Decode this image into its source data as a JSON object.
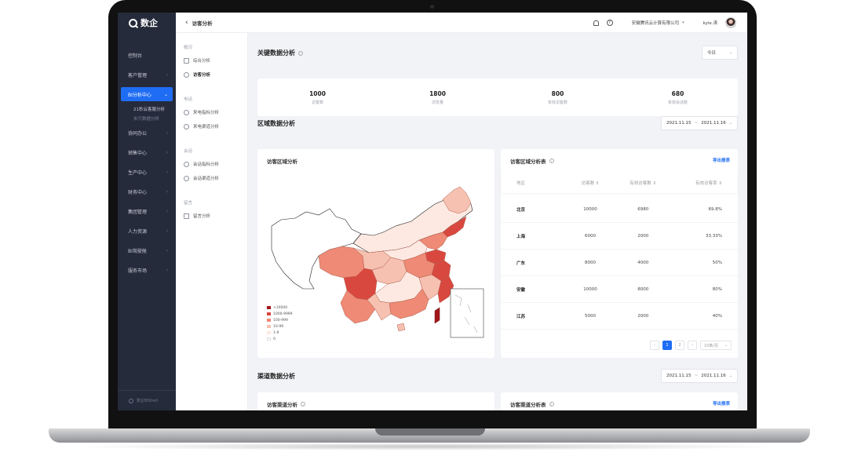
{
  "app": {
    "logo_text": "数企"
  },
  "sidebar": {
    "items": [
      {
        "label": "控制台"
      },
      {
        "label": "客户管理"
      },
      {
        "label": "BI分析中心"
      },
      {
        "label": "协同办公"
      },
      {
        "label": "销售中心"
      },
      {
        "label": "生产中心"
      },
      {
        "label": "财务中心"
      },
      {
        "label": "集团管理"
      },
      {
        "label": "人力资源"
      },
      {
        "label": "BI驾驶舱"
      },
      {
        "label": "服务市场"
      }
    ],
    "subitems": [
      {
        "label": "21秒云客服分析"
      },
      {
        "label": "米只数据分析"
      }
    ],
    "footer_text": "数企BIShell"
  },
  "topbar": {
    "back_icon": "chevron-left-icon",
    "title": "访客分析",
    "help_glyph": "?",
    "company": "安徽腾讯云计算有限公司",
    "user": "kyle.涛"
  },
  "submenu": {
    "groups": [
      {
        "title": "概况",
        "items": [
          {
            "label": "综合分析"
          },
          {
            "label": "访客分析"
          }
        ]
      },
      {
        "title": "电话",
        "items": [
          {
            "label": "来电指标分析"
          },
          {
            "label": "来电渠道分析"
          }
        ]
      },
      {
        "title": "会话",
        "items": [
          {
            "label": "会话指标分析"
          },
          {
            "label": "会话渠道分析"
          }
        ]
      },
      {
        "title": "留言",
        "items": [
          {
            "label": "留言分析"
          }
        ]
      }
    ]
  },
  "key_data": {
    "title": "关键数据分析",
    "period": "今日",
    "metrics": [
      {
        "value": "1000",
        "label": "访客数"
      },
      {
        "value": "1800",
        "label": "浏览量"
      },
      {
        "value": "800",
        "label": "有效访客数"
      },
      {
        "value": "680",
        "label": "有效会话数"
      }
    ]
  },
  "region": {
    "title": "区域数据分析",
    "date_start": "2021.11.15",
    "date_sep": "~",
    "date_end": "2021.11.16",
    "map_title": "访客区域分析",
    "legend": [
      {
        "label": ">10000",
        "color": "#a3161a"
      },
      {
        "label": "1000-9999",
        "color": "#d9483f"
      },
      {
        "label": "100-999",
        "color": "#ee8a75"
      },
      {
        "label": "10-99",
        "color": "#f7c1b1"
      },
      {
        "label": "1-9",
        "color": "#fde9e2"
      },
      {
        "label": "0",
        "color": "#ffffff"
      }
    ],
    "table_title": "访客区域分析表",
    "export_label": "导出报表",
    "columns": [
      "地区",
      "访客数 ⇕",
      "有效访客数 ⇕",
      "有效访客率 ⇕"
    ],
    "rows": [
      {
        "region": "北京",
        "visitors": "10000",
        "valid": "6980",
        "rate": "69.8%"
      },
      {
        "region": "上海",
        "visitors": "6000",
        "valid": "2000",
        "rate": "33.33%"
      },
      {
        "region": "广东",
        "visitors": "8000",
        "valid": "4000",
        "rate": "50%"
      },
      {
        "region": "安徽",
        "visitors": "10000",
        "valid": "8000",
        "rate": "80%"
      },
      {
        "region": "江苏",
        "visitors": "5000",
        "valid": "2000",
        "rate": "40%"
      }
    ],
    "pagination": {
      "prev": "‹",
      "current": "1",
      "next_page": "2",
      "next": "›",
      "page_size": "10条/页"
    }
  },
  "channel": {
    "title": "渠道数据分析",
    "date_start": "2021.11.15",
    "date_sep": "~",
    "date_end": "2021.11.16",
    "left_title": "访客渠道分析",
    "right_title": "访客渠道分析表",
    "export_label": "导出报表"
  }
}
